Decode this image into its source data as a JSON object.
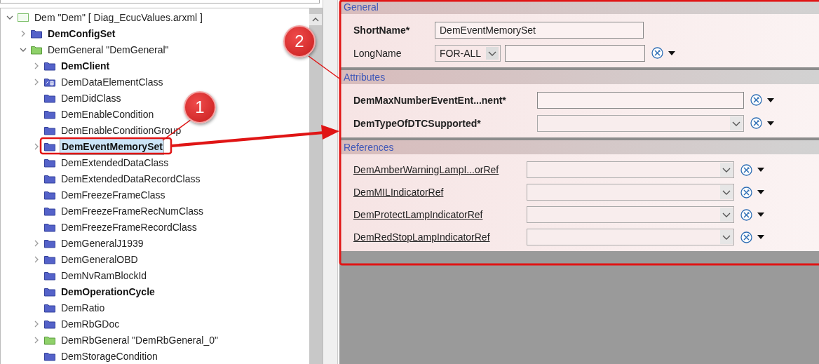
{
  "tree": [
    {
      "label": "Dem \"Dem\" [ Diag_EcucValues.arxml ]",
      "kind": "module",
      "bold": false,
      "expanded": true,
      "selected": false,
      "children": [
        {
          "label": "DemConfigSet",
          "kind": "folder",
          "bold": true,
          "expanded": false,
          "selected": false
        },
        {
          "label": "DemGeneral \"DemGeneral\"",
          "kind": "container",
          "bold": false,
          "expanded": true,
          "selected": false,
          "children": [
            {
              "label": "DemClient",
              "kind": "folder",
              "bold": true,
              "expanded": false,
              "selected": false
            },
            {
              "label": "DemDataElementClass",
              "kind": "choice",
              "bold": false,
              "expanded": false,
              "selected": false
            },
            {
              "label": "DemDidClass",
              "kind": "folder",
              "bold": false,
              "selected": false
            },
            {
              "label": "DemEnableCondition",
              "kind": "folder",
              "bold": false,
              "selected": false
            },
            {
              "label": "DemEnableConditionGroup",
              "kind": "folder",
              "bold": false,
              "selected": false
            },
            {
              "label": "DemEventMemorySet",
              "kind": "folder",
              "bold": true,
              "expanded": false,
              "selected": true
            },
            {
              "label": "DemExtendedDataClass",
              "kind": "folder",
              "bold": false,
              "selected": false
            },
            {
              "label": "DemExtendedDataRecordClass",
              "kind": "folder",
              "bold": false,
              "selected": false
            },
            {
              "label": "DemFreezeFrameClass",
              "kind": "folder",
              "bold": false,
              "selected": false
            },
            {
              "label": "DemFreezeFrameRecNumClass",
              "kind": "folder",
              "bold": false,
              "selected": false
            },
            {
              "label": "DemFreezeFrameRecordClass",
              "kind": "folder",
              "bold": false,
              "selected": false
            },
            {
              "label": "DemGeneralJ1939",
              "kind": "folder",
              "bold": false,
              "expanded": false,
              "selected": false
            },
            {
              "label": "DemGeneralOBD",
              "kind": "folder",
              "bold": false,
              "expanded": false,
              "selected": false
            },
            {
              "label": "DemNvRamBlockId",
              "kind": "folder",
              "bold": false,
              "selected": false
            },
            {
              "label": "DemOperationCycle",
              "kind": "folder",
              "bold": true,
              "selected": false
            },
            {
              "label": "DemRatio",
              "kind": "folder",
              "bold": false,
              "selected": false
            },
            {
              "label": "DemRbGDoc",
              "kind": "folder",
              "bold": false,
              "expanded": false,
              "selected": false
            },
            {
              "label": "DemRbGeneral \"DemRbGeneral_0\"",
              "kind": "container",
              "bold": false,
              "expanded": false,
              "selected": false
            },
            {
              "label": "DemStorageCondition",
              "kind": "folder",
              "bold": false,
              "selected": false
            }
          ]
        }
      ]
    }
  ],
  "sections": [
    {
      "title": "General",
      "rows": [
        {
          "label": "ShortName*",
          "bold": true,
          "link": false,
          "kind": "text",
          "value": "DemEventMemorySet",
          "tools": false
        },
        {
          "label": "LongName",
          "bold": false,
          "link": false,
          "kind": "language",
          "language": "FOR-ALL",
          "tools": true
        }
      ]
    },
    {
      "title": "Attributes",
      "rows": [
        {
          "label": "DemMaxNumberEventEnt...nent*",
          "bold": true,
          "link": false,
          "kind": "text",
          "tools": true
        },
        {
          "label": "DemTypeOfDTCSupported*",
          "bold": true,
          "link": false,
          "kind": "select",
          "tools": true
        }
      ]
    },
    {
      "title": "References",
      "rows": [
        {
          "label": "DemAmberWarningLampI...orRef",
          "bold": false,
          "link": true,
          "kind": "select",
          "tools": true
        },
        {
          "label": "DemMILIndicatorRef",
          "bold": false,
          "link": true,
          "kind": "select",
          "tools": true
        },
        {
          "label": "DemProtectLampIndicatorRef",
          "bold": false,
          "link": true,
          "kind": "select",
          "tools": true
        },
        {
          "label": "DemRedStopLampIndicatorRef",
          "bold": false,
          "link": true,
          "kind": "select",
          "tools": true
        }
      ]
    }
  ],
  "annotations": [
    {
      "label": "1"
    },
    {
      "label": "2"
    }
  ]
}
